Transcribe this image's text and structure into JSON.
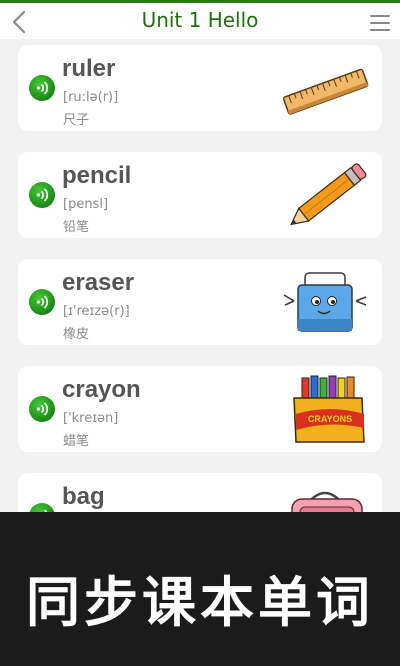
{
  "header": {
    "title": "Unit 1 Hello",
    "back_icon": "chevron-left-icon",
    "menu_icon": "hamburger-menu-icon"
  },
  "words": [
    {
      "word": "ruler",
      "phonetic": "[ru:lə(r)]",
      "meaning": "尺子",
      "image": "ruler"
    },
    {
      "word": "pencil",
      "phonetic": "[pensl]",
      "meaning": "铅笔",
      "image": "pencil"
    },
    {
      "word": "eraser",
      "phonetic": "[ɪ'reɪzə(r)]",
      "meaning": "橡皮",
      "image": "eraser"
    },
    {
      "word": "crayon",
      "phonetic": "['kreɪən]",
      "meaning": "蜡笔",
      "image": "crayon"
    },
    {
      "word": "bag",
      "phonetic": "",
      "meaning": "",
      "image": "bag"
    }
  ],
  "images": {
    "crayon_box_text": "CRAYONS"
  },
  "banner": {
    "text": "同步课本单词"
  },
  "colors": {
    "accent": "#1f6f12",
    "audio": "#2aa41f",
    "banner_bg": "#1b1b1b"
  }
}
